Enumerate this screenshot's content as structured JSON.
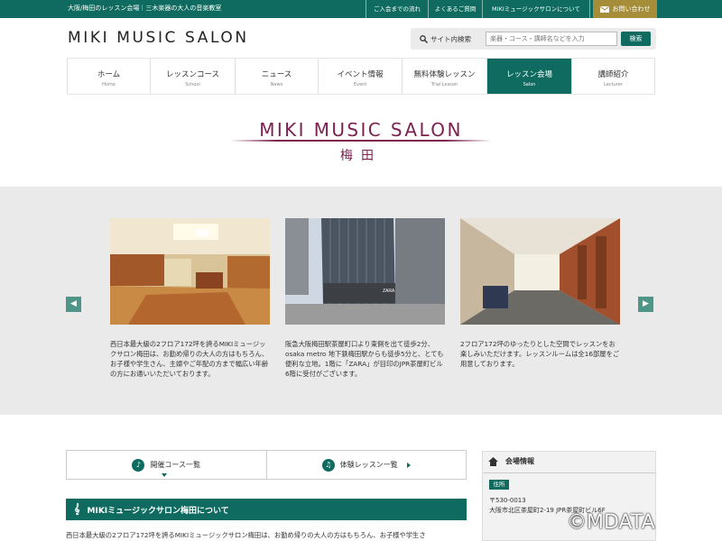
{
  "topbar": {
    "tagline": "大阪/梅田のレッスン会場｜三木楽器の大人の音楽教室",
    "links": [
      "ご入会までの流れ",
      "よくあるご質問",
      "MIKIミュージックサロンについて"
    ],
    "contact_label": "お問い合わせ"
  },
  "header": {
    "logo_text": "MIKI MUSIC SALON",
    "search_label": "サイト内検索",
    "search_placeholder": "楽器・コース・講師名などを入力",
    "search_button": "検索"
  },
  "nav": {
    "items": [
      {
        "jp": "ホーム",
        "en": "Home"
      },
      {
        "jp": "レッスンコース",
        "en": "School"
      },
      {
        "jp": "ニュース",
        "en": "News"
      },
      {
        "jp": "イベント情報",
        "en": "Event"
      },
      {
        "jp": "無料体験レッスン",
        "en": "Trial Lesson"
      },
      {
        "jp": "レッスン会場",
        "en": "Salon"
      },
      {
        "jp": "講師紹介",
        "en": "Lecturer"
      }
    ],
    "active_index": 5
  },
  "banner": {
    "title": "MIKI MUSIC SALON",
    "subtitle": "梅田"
  },
  "carousel": {
    "prev_icon": "chevron-left-icon",
    "next_icon": "chevron-right-icon",
    "slides": [
      {
        "text": "西日本最大級の2フロア172坪を誇るMIKIミュージックサロン梅田は、お勤め帰りの大人の方はもちろん、お子様や学生さん、主婦やご年配の方まで幅広い年齢の方にお通いいただいております。"
      },
      {
        "text": "阪急大阪梅田駅茶屋町口より東側を出て徒歩2分、osaka metro 地下鉄梅田駅からも徒歩5分と、とても便利な立地。1階に「ZARA」が目印のJPR茶屋町ビル 6階に受付がございます。"
      },
      {
        "text": "2フロア172坪のゆったりとした空間でレッスンをお楽しみいただけます。レッスンルームは全16部屋をご用意しております。"
      }
    ]
  },
  "cards": [
    {
      "label": "開催コース一覧",
      "icon": "guitar-icon"
    },
    {
      "label": "体験レッスン一覧",
      "icon": "music-note-icon"
    }
  ],
  "about": {
    "heading": "MIKIミュージックサロン梅田について",
    "icon": "treble-clef-icon",
    "body": "西日本最大級の2フロア172坪を誇るMIKIミュージックサロン梅田は、お勤め帰りの大人の方はもちろん、お子様や学生さ"
  },
  "sidebar": {
    "heading": "会場情報",
    "icon": "home-icon",
    "address_tag": "住所",
    "postal": "〒530-0013",
    "address": "大阪市北区茶屋町2-19 JPR茶屋町ビル6F"
  },
  "watermark": "©MDATA",
  "colors": {
    "accent": "#0f6b5f",
    "brand_title": "#7c2150",
    "contact": "#a58d3a"
  }
}
